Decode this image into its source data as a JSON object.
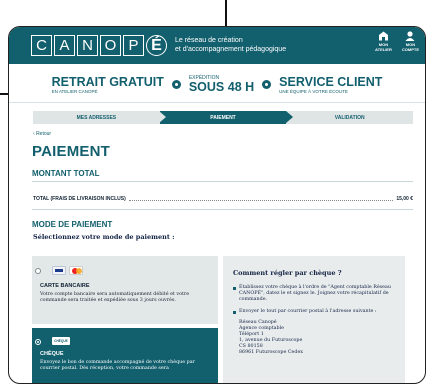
{
  "header": {
    "logo_letters": [
      "C",
      "A",
      "N",
      "O",
      "P",
      "É"
    ],
    "tagline_line1": "Le réseau de création",
    "tagline_line2": "et d'accompagnement pédagogique",
    "icons": [
      {
        "name": "store-icon",
        "line1": "MON",
        "line2": "ATELIER"
      },
      {
        "name": "account-icon",
        "line1": "MON",
        "line2": "COMPTE"
      }
    ]
  },
  "promo": {
    "retrait_title": "RETRAIT GRATUIT",
    "retrait_sub": "EN ATELIER CANOPÉ",
    "expedition_label": "EXPÉDITION",
    "expedition_value": "SOUS 48 H",
    "service_title": "SERVICE CLIENT",
    "service_sub": "UNE ÉQUIPE À VOTRE ÉCOUTE"
  },
  "steps": [
    "MES ADRESSES",
    "PAIEMENT",
    "VALIDATION"
  ],
  "back_label": "Retour",
  "page_title": "PAIEMENT",
  "montant": {
    "heading": "MONTANT TOTAL",
    "label": "TOTAL (FRAIS DE LIVRAISON INCLUS)",
    "value": "15,00 €"
  },
  "mode": {
    "heading": "MODE DE PAIEMENT",
    "instruction": "Sélectionnez votre mode de paiement :"
  },
  "options": {
    "card": {
      "title": "CARTE BANCAIRE",
      "text": "Votre compte bancaire sera automatiquement débité et votre commande sera traitée et expédiée sous 3 jours ouvrés."
    },
    "cheque": {
      "badge": "CHÈQUE",
      "title": "CHÈQUE",
      "text": "Envoyez le bon de commande accompagné de votre chèque par courrier postal. Dès réception, votre commande sera"
    }
  },
  "info": {
    "title": "Comment régler par chèque ?",
    "bullet1": "Établissez votre chèque à l'ordre de \"Agent comptable Réseau CANOPÉ\", datez le et signez le. Joignez votre récapitulatif de commande.",
    "bullet2": "Envoyer le tout par courrier postal à l'adresse suivante :",
    "address": [
      "Réseau Canopé",
      "Agence comptable",
      "Téléport 1",
      "1, avenue du Futuroscope",
      "CS 80158",
      "86961 Futuroscope Cedex"
    ]
  }
}
